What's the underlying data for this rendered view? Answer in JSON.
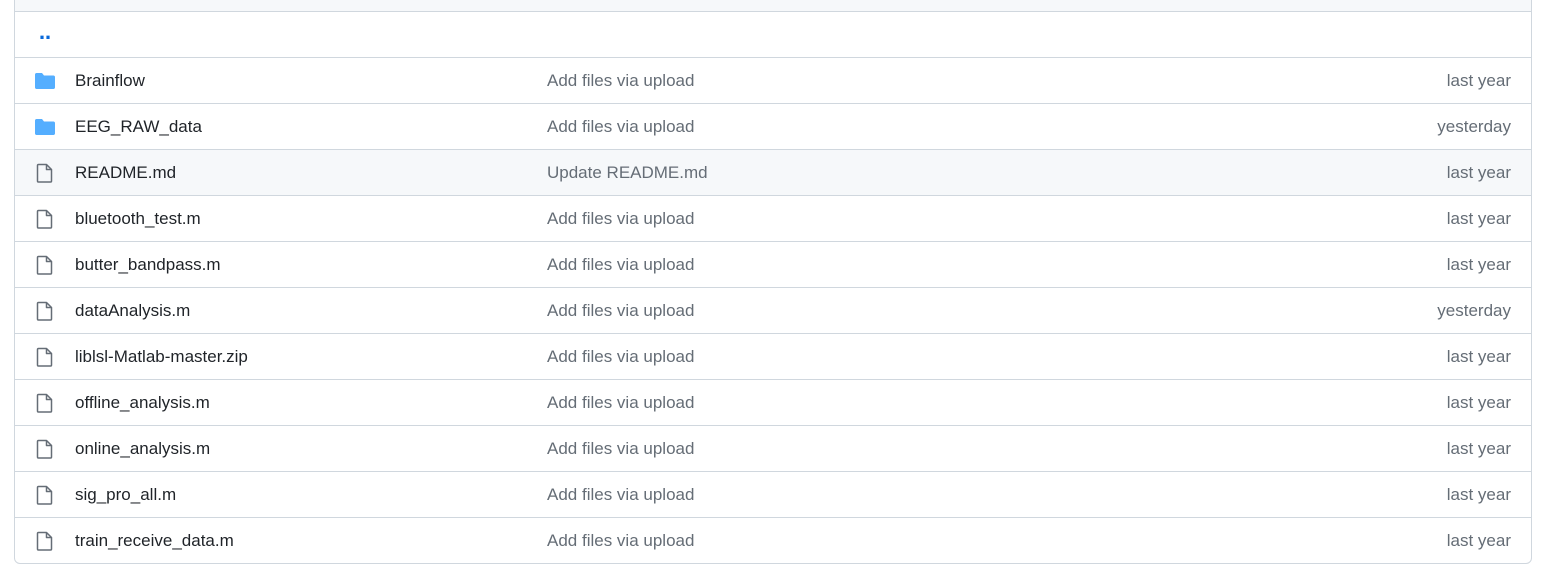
{
  "file_table": {
    "parent_link": "‥",
    "rows": [
      {
        "type": "folder",
        "icon": "folder-icon",
        "name": "Brainflow",
        "message": "Add files via upload",
        "date": "last year"
      },
      {
        "type": "folder",
        "icon": "folder-icon",
        "name": "EEG_RAW_data",
        "message": "Add files via upload",
        "date": "yesterday"
      },
      {
        "type": "file",
        "icon": "file-icon",
        "name": "README.md",
        "message": "Update README.md",
        "date": "last year",
        "hovered": true
      },
      {
        "type": "file",
        "icon": "file-icon",
        "name": "bluetooth_test.m",
        "message": "Add files via upload",
        "date": "last year"
      },
      {
        "type": "file",
        "icon": "file-icon",
        "name": "butter_bandpass.m",
        "message": "Add files via upload",
        "date": "last year"
      },
      {
        "type": "file",
        "icon": "file-icon",
        "name": "dataAnalysis.m",
        "message": "Add files via upload",
        "date": "yesterday"
      },
      {
        "type": "file",
        "icon": "file-icon",
        "name": "liblsl-Matlab-master.zip",
        "message": "Add files via upload",
        "date": "last year"
      },
      {
        "type": "file",
        "icon": "file-icon",
        "name": "offline_analysis.m",
        "message": "Add files via upload",
        "date": "last year"
      },
      {
        "type": "file",
        "icon": "file-icon",
        "name": "online_analysis.m",
        "message": "Add files via upload",
        "date": "last year"
      },
      {
        "type": "file",
        "icon": "file-icon",
        "name": "sig_pro_all.m",
        "message": "Add files via upload",
        "date": "last year"
      },
      {
        "type": "file",
        "icon": "file-icon",
        "name": "train_receive_data.m",
        "message": "Add files via upload",
        "date": "last year"
      }
    ]
  },
  "colors": {
    "folder": "#54aeff",
    "file_icon": "#656d76",
    "link": "#0969da",
    "border": "#d0d7de",
    "hover_bg": "#f6f8fa"
  }
}
